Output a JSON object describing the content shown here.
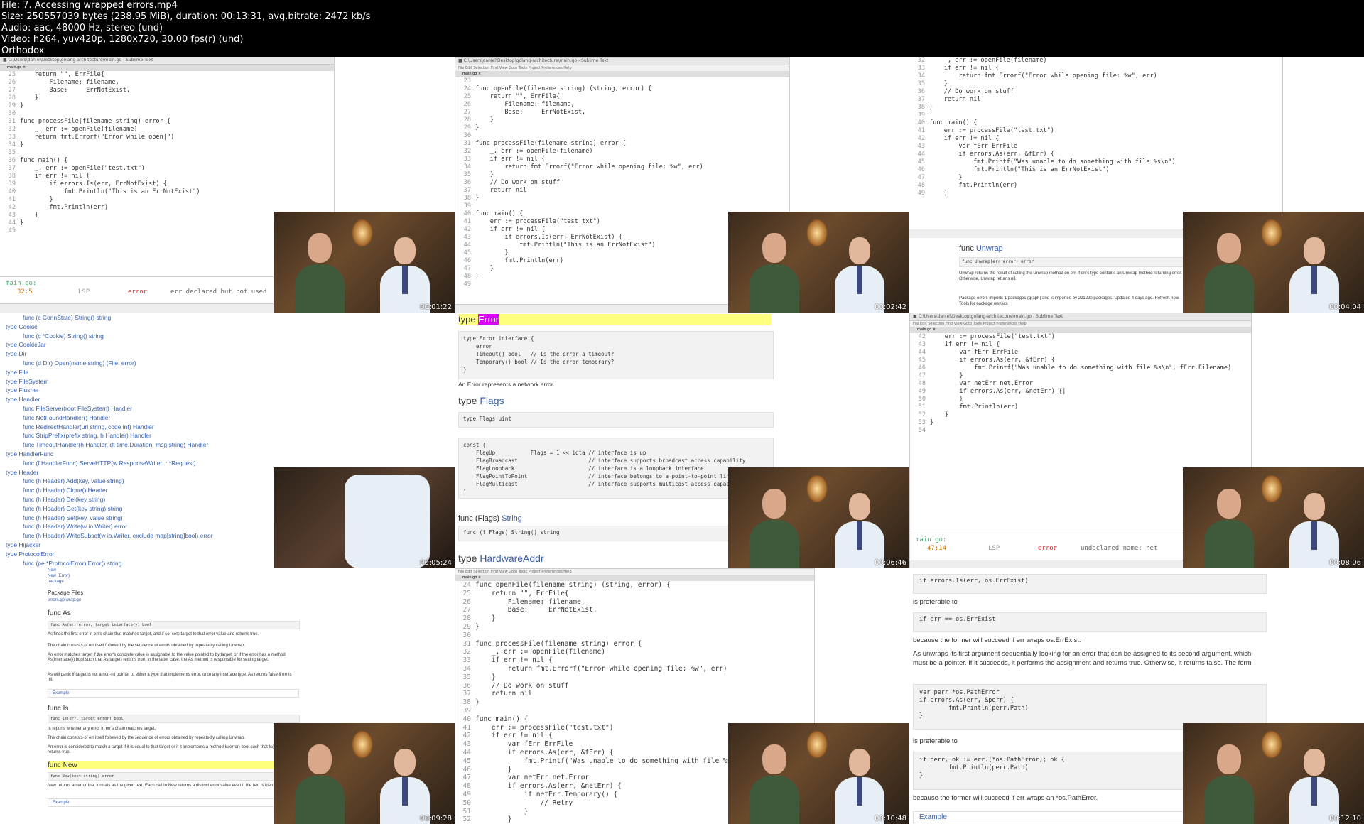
{
  "header": {
    "file": "File: 7. Accessing wrapped errors.mp4",
    "size": "Size: 250557039 bytes (238.95 MiB), duration: 00:13:31, avg.bitrate: 2472 kb/s",
    "audio": "Audio: aac, 48000 Hz, stereo (und)",
    "video": "Video: h264, yuv420p, 1280x720, 30.00 fps(r) (und)",
    "brand": "Orthodox"
  },
  "timestamps": [
    "00:01:22",
    "00:02:42",
    "00:04:04",
    "00:05:24",
    "00:06:46",
    "00:08:06",
    "00:09:28",
    "00:10:48",
    "00:12:10"
  ],
  "tile1": {
    "lines": [
      [
        "25",
        "    return \"\", ErrFile{"
      ],
      [
        "26",
        "        Filename: filename,"
      ],
      [
        "27",
        "        Base:     ErrNotExist,"
      ],
      [
        "28",
        "    }"
      ],
      [
        "29",
        "}"
      ],
      [
        "30",
        ""
      ],
      [
        "31",
        "func processFile(filename string) error {"
      ],
      [
        "32",
        "    _, err := openFile(filename)"
      ],
      [
        "33",
        "    return fmt.Errorf(\"Error while open|\")"
      ],
      [
        "34",
        "}"
      ],
      [
        "35",
        ""
      ],
      [
        "36",
        "func main() {"
      ],
      [
        "37",
        "    _, err := openFile(\"test.txt\")"
      ],
      [
        "38",
        "    if err != nil {"
      ],
      [
        "39",
        "        if errors.Is(err, ErrNotExist) {"
      ],
      [
        "40",
        "            fmt.Println(\"This is an ErrNotExist\")"
      ],
      [
        "41",
        "        }"
      ],
      [
        "42",
        "        fmt.Println(err)"
      ],
      [
        "43",
        "    }"
      ],
      [
        "44",
        "}"
      ],
      [
        "45",
        ""
      ]
    ],
    "diag_file": "main.go:",
    "diag_pos": "32:5",
    "diag_src": "LSP",
    "diag_level": "error",
    "diag_msg": "err declared but not used"
  },
  "tile2": {
    "lines": [
      [
        "23",
        ""
      ],
      [
        "24",
        "func openFile(filename string) (string, error) {"
      ],
      [
        "25",
        "    return \"\", ErrFile{"
      ],
      [
        "26",
        "        Filename: filename,"
      ],
      [
        "27",
        "        Base:     ErrNotExist,"
      ],
      [
        "28",
        "    }"
      ],
      [
        "29",
        "}"
      ],
      [
        "30",
        ""
      ],
      [
        "31",
        "func processFile(filename string) error {"
      ],
      [
        "32",
        "    _, err := openFile(filename)"
      ],
      [
        "33",
        "    if err != nil {"
      ],
      [
        "34",
        "        return fmt.Errorf(\"Error while opening file: %w\", err)"
      ],
      [
        "35",
        "    }"
      ],
      [
        "36",
        "    // Do work on stuff"
      ],
      [
        "37",
        "    return nil"
      ],
      [
        "38",
        "}"
      ],
      [
        "39",
        ""
      ],
      [
        "40",
        "func main() {"
      ],
      [
        "41",
        "    err := processFile(\"test.txt\")"
      ],
      [
        "42",
        "    if err != nil {"
      ],
      [
        "43",
        "        if errors.Is(err, ErrNotExist) {"
      ],
      [
        "44",
        "            fmt.Println(\"This is an ErrNotExist\")"
      ],
      [
        "45",
        "        }"
      ],
      [
        "46",
        "        fmt.Println(err)"
      ],
      [
        "47",
        "    }"
      ],
      [
        "48",
        "}"
      ],
      [
        "49",
        ""
      ]
    ]
  },
  "tile3": {
    "lines": [
      [
        "32",
        "    _, err := openFile(filename)"
      ],
      [
        "33",
        "    if err != nil {"
      ],
      [
        "34",
        "        return fmt.Errorf(\"Error while opening file: %w\", err)"
      ],
      [
        "35",
        "    }"
      ],
      [
        "36",
        "    // Do work on stuff"
      ],
      [
        "37",
        "    return nil"
      ],
      [
        "38",
        "}"
      ],
      [
        "39",
        ""
      ],
      [
        "40",
        "func main() {"
      ],
      [
        "41",
        "    err := processFile(\"test.txt\")"
      ],
      [
        "42",
        "    if err != nil {"
      ],
      [
        "43",
        "        var fErr ErrFile"
      ],
      [
        "44",
        "        if errors.As(err, &fErr) {"
      ],
      [
        "45",
        "            fmt.Printf(\"Was unable to do something with file %s\\n\")"
      ],
      [
        "46",
        "            fmt.Println(\"This is an ErrNotExist\")"
      ],
      [
        "47",
        "        }"
      ],
      [
        "48",
        "        fmt.Println(err)"
      ],
      [
        "49",
        "    }"
      ]
    ],
    "doc_title_prefix": "func ",
    "doc_title": "Unwrap",
    "doc_sig": "func Unwrap(err error) error",
    "doc_desc": "Unwrap returns the result of calling the Unwrap method on err, if err's type contains an Unwrap method returning error. Otherwise, Unwrap returns nil.",
    "doc_footer": "Package errors imports 1 packages (graph) and is imported by 221290 packages. Updated 4 days ago. Refresh now. Tools for package owners."
  },
  "tile4": {
    "items": [
      [
        "sub",
        "func (c ConnState) String() string"
      ],
      [
        "type",
        "type Cookie"
      ],
      [
        "sub",
        "func (c *Cookie) String() string"
      ],
      [
        "type",
        "type CookieJar"
      ],
      [
        "type",
        "type Dir"
      ],
      [
        "sub",
        "func (d Dir) Open(name string) (File, error)"
      ],
      [
        "type",
        "type File"
      ],
      [
        "type",
        "type FileSystem"
      ],
      [
        "type",
        "type Flusher"
      ],
      [
        "type",
        "type Handler"
      ],
      [
        "sub",
        "func FileServer(root FileSystem) Handler"
      ],
      [
        "sub",
        "func NotFoundHandler() Handler"
      ],
      [
        "sub",
        "func RedirectHandler(url string, code int) Handler"
      ],
      [
        "sub",
        "func StripPrefix(prefix string, h Handler) Handler"
      ],
      [
        "sub",
        "func TimeoutHandler(h Handler, dt time.Duration, msg string) Handler"
      ],
      [
        "type",
        "type HandlerFunc"
      ],
      [
        "sub",
        "func (f HandlerFunc) ServeHTTP(w ResponseWriter, r *Request)"
      ],
      [
        "type",
        "type Header"
      ],
      [
        "sub",
        "func (h Header) Add(key, value string)"
      ],
      [
        "sub",
        "func (h Header) Clone() Header"
      ],
      [
        "sub",
        "func (h Header) Del(key string)"
      ],
      [
        "sub",
        "func (h Header) Get(key string) string"
      ],
      [
        "sub",
        "func (h Header) Set(key, value string)"
      ],
      [
        "sub",
        "func (h Header) Write(w io.Writer) error"
      ],
      [
        "sub",
        "func (h Header) WriteSubset(w io.Writer, exclude map[string]bool) error"
      ],
      [
        "type",
        "type Hijacker"
      ],
      [
        "type",
        "type ProtocolError"
      ],
      [
        "sub",
        "func (pe *ProtocolError) Error() string"
      ]
    ]
  },
  "tile5": {
    "type_kw": "type ",
    "type_name": "Error",
    "iface_code": "type Error interface {\n    error\n    Timeout() bool   // Is the error a timeout?\n    Temporary() bool // Is the error temporary?\n}",
    "iface_desc": "An Error represents a network error.",
    "flags_title": "Flags",
    "flags_sig": "type Flags uint",
    "const_code": "const (\n    FlagUp           Flags = 1 << iota // interface is up\n    FlagBroadcast                      // interface supports broadcast access capability\n    FlagLoopback                       // interface is a loopback interface\n    FlagPointToPoint                   // interface belongs to a point-to-point link\n    FlagMulticast                      // interface supports multicast access capab\n)",
    "string_title_prefix": "func (Flags) ",
    "string_title": "String",
    "string_sig": "func (f Flags) String() string",
    "hw_title": "HardwareAddr"
  },
  "tile6": {
    "lines": [
      [
        "42",
        "    err := processFile(\"test.txt\")"
      ],
      [
        "43",
        "    if err != nil {"
      ],
      [
        "44",
        "        var fErr ErrFile"
      ],
      [
        "45",
        "        if errors.As(err, &fErr) {"
      ],
      [
        "46",
        "            fmt.Printf(\"Was unable to do something with file %s\\n\", fErr.Filename)"
      ],
      [
        "47",
        "        }"
      ],
      [
        "48",
        "        var netErr net.Error"
      ],
      [
        "49",
        "        if errors.As(err, &netErr) {|"
      ],
      [
        "50",
        "        }"
      ],
      [
        "51",
        "        fmt.Println(err)"
      ],
      [
        "52",
        "    }"
      ],
      [
        "53",
        "}"
      ],
      [
        "54",
        ""
      ]
    ],
    "diag_file": "main.go:",
    "diag_pos": "47:14",
    "diag_src": "LSP",
    "diag_level": "error",
    "diag_msg": "undeclared name: net"
  },
  "tile7": {
    "top_items": [
      "New",
      "New (Error)",
      "package"
    ],
    "pkg_files": "Package Files",
    "pkg_file_names": "errors.go wrap.go",
    "as_title": "func As",
    "as_sig": "func As(err error, target interface{}) bool",
    "as_p1": "As finds the first error in err's chain that matches target, and if so, sets target to that error value and returns true.",
    "as_p2": "The chain consists of err itself followed by the sequence of errors obtained by repeatedly calling Unwrap.",
    "as_p3": "An error matches target if the error's concrete value is assignable to the value pointed to by target, or if the error has a method As(interface{}) bool such that As(target) returns true. In the latter case, the As method is responsible for setting target.",
    "as_p4": "As will panic if target is not a non-nil pointer to either a type that implements error, or to any interface type. As returns false if err is nil.",
    "example": "Example",
    "is_title": "func Is",
    "is_sig": "func Is(err, target error) bool",
    "is_p1": "Is reports whether any error in err's chain matches target.",
    "is_p2": "The chain consists of err itself followed by the sequence of errors obtained by repeatedly calling Unwrap.",
    "is_p3": "An error is considered to match a target if it is equal to that target or if it implements a method Is(error) bool such that Is(target) returns true.",
    "new_title": "func New",
    "new_sig": "func New(text string) error",
    "new_p1": "New returns an error that formats as the given text. Each call to New returns a distinct error value even if the text is identical.",
    "example2": "Example"
  },
  "tile8": {
    "lines": [
      [
        "24",
        "func openFile(filename string) (string, error) {"
      ],
      [
        "25",
        "    return \"\", ErrFile{"
      ],
      [
        "26",
        "        Filename: filename,"
      ],
      [
        "27",
        "        Base:     ErrNotExist,"
      ],
      [
        "28",
        "    }"
      ],
      [
        "29",
        "}"
      ],
      [
        "30",
        ""
      ],
      [
        "31",
        "func processFile(filename string) error {"
      ],
      [
        "32",
        "    _, err := openFile(filename)"
      ],
      [
        "33",
        "    if err != nil {"
      ],
      [
        "34",
        "        return fmt.Errorf(\"Error while opening file: %w\", err)"
      ],
      [
        "35",
        "    }"
      ],
      [
        "36",
        "    // Do work on stuff"
      ],
      [
        "37",
        "    return nil"
      ],
      [
        "38",
        "}"
      ],
      [
        "39",
        ""
      ],
      [
        "40",
        "func main() {"
      ],
      [
        "41",
        "    err := processFile(\"test.txt\")"
      ],
      [
        "42",
        "    if err != nil {"
      ],
      [
        "43",
        "        var fErr ErrFile"
      ],
      [
        "44",
        "        if errors.As(err, &fErr) {"
      ],
      [
        "45",
        "            fmt.Printf(\"Was unable to do something with file %s\\"
      ],
      [
        "46",
        "        }"
      ],
      [
        "47",
        "        var netErr net.Error"
      ],
      [
        "48",
        "        if errors.As(err, &netErr) {"
      ],
      [
        "49",
        "            if netErr.Temporary() {"
      ],
      [
        "50",
        "                // Retry"
      ],
      [
        "51",
        "            }"
      ],
      [
        "52",
        "        }"
      ]
    ]
  },
  "tile9": {
    "code1": "if errors.Is(err, os.ErrExist)",
    "pref1": "is preferable to",
    "code2": "if err == os.ErrExist",
    "because1": "because the former will succeed if err wraps os.ErrExist.",
    "as_desc": "As unwraps its first argument sequentially looking for an error that can be assigned to its second argument, which must be a pointer. If it succeeds, it performs the assignment and returns true. Otherwise, it returns false. The form",
    "code3": "var perr *os.PathError\nif errors.As(err, &perr) {\n        fmt.Println(perr.Path)\n}",
    "pref2": "is preferable to",
    "code4": "if perr, ok := err.(*os.PathError); ok {\n        fmt.Println(perr.Path)\n}",
    "because2": "because the former will succeed if err wraps an *os.PathError.",
    "example": "Example"
  }
}
